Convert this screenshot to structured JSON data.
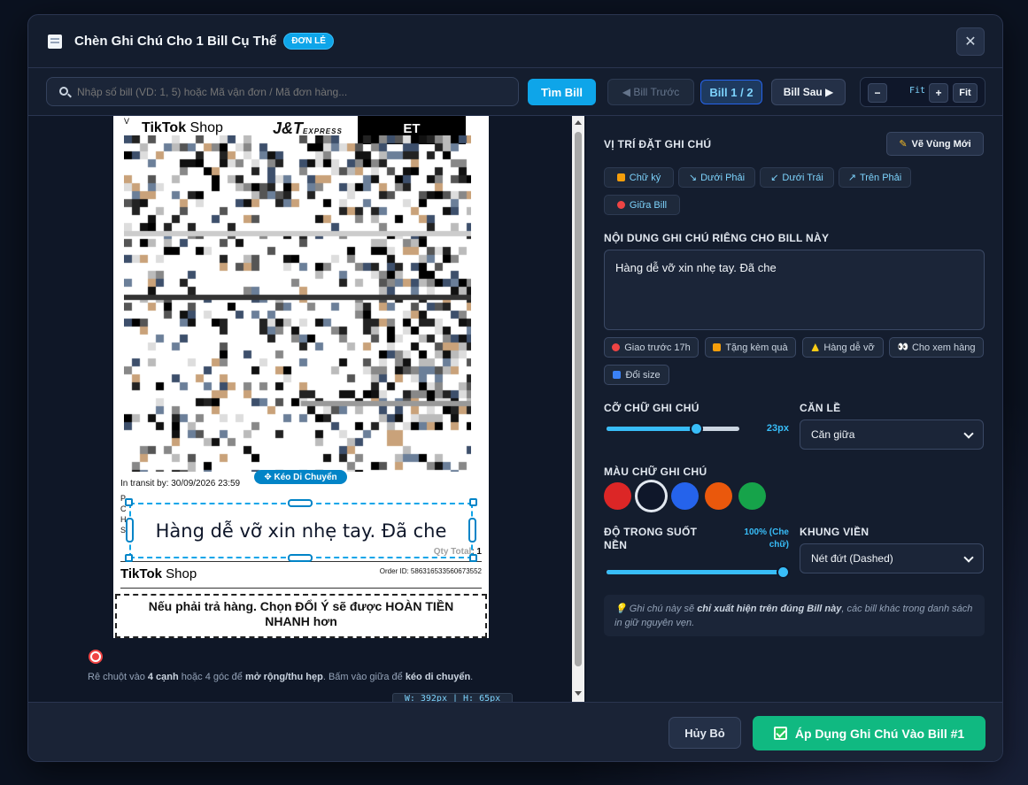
{
  "modal": {
    "title": "Chèn Ghi Chú Cho 1 Bill Cụ Thể",
    "badge": "ĐƠN LẺ",
    "close": "✕"
  },
  "toolbar": {
    "search_placeholder": "Nhập số bill (VD: 1, 5) hoặc Mã vận đơn / Mã đơn hàng...",
    "find": "Tìm Bill",
    "prev": "◀ Bill Trước",
    "counter": "Bill 1 / 2",
    "next": "Bill Sau ▶",
    "zoom_minus": "−",
    "zoom_level": "Fit",
    "zoom_plus": "+",
    "zoom_fit": "Fit"
  },
  "bill": {
    "tiktok": "TikTok",
    "shop": " Shop",
    "jt": "J&T",
    "jt_sub": "EXPRESS",
    "et": "ET",
    "v": "V",
    "transit": "In transit by: 30/09/2026 23:59",
    "left_letters": [
      "P",
      "C",
      "H",
      "S"
    ],
    "qty": "Qty Total: 1",
    "order_id": "Order ID: 586316533560673552",
    "return_text": "Nếu phải trả hàng. Chọn ĐỔI Ý sẽ được HOÀN TIỀN NHANH hơn"
  },
  "note_overlay": {
    "text": "Hàng dễ vỡ xin nhẹ tay. Đã che",
    "drag_label": "✥ Kéo Di Chuyển",
    "dims": "W: 392px | H: 65px"
  },
  "hint": {
    "p1": "Rê chuột vào ",
    "b1": "4 cạnh",
    "p2": " hoặc 4 góc để ",
    "b2": "mở rộng/thu hẹp",
    "p3": ". Bấm vào giữa để ",
    "b3": "kéo di chuyển",
    "p4": "."
  },
  "panel": {
    "position_label": "VỊ TRÍ ĐẶT GHI CHÚ",
    "draw_new": "Vẽ Vùng Mới",
    "positions": [
      "Chữ ký",
      "Dưới Phải",
      "Dưới Trái",
      "Trên Phải",
      "Giữa Bill"
    ],
    "content_label": "NỘI DUNG GHI CHÚ RIÊNG CHO BILL NÀY",
    "content_value": "Hàng dễ vỡ xin nhẹ tay. Đã che",
    "quick": [
      "Giao trước 17h",
      "Tặng kèm quà",
      "Hàng dễ vỡ",
      "Cho xem hàng",
      "Đổi size"
    ],
    "font_size_label": "CỠ CHỮ GHI CHÚ",
    "font_size_value": "23px",
    "font_size_fraction": 0.68,
    "align_label": "CĂN LỀ",
    "align_value": "Căn giữa",
    "color_label": "MÀU CHỮ GHI CHÚ",
    "colors": [
      "#dc2626",
      "#0f172a",
      "#2563eb",
      "#ea580c",
      "#16a34a"
    ],
    "selected_color": 1,
    "opacity_label": "ĐỘ TRONG SUỐT NỀN",
    "opacity_value": "100% (Che chữ)",
    "opacity_fraction": 1.0,
    "border_label": "KHUNG VIỀN",
    "border_value": "Nét đứt (Dashed)",
    "info_p1": "💡 Ghi chú này sẽ ",
    "info_b": "chỉ xuất hiện trên đúng Bill này",
    "info_p2": ", các bill khác trong danh sách in giữ nguyên vẹn."
  },
  "footer": {
    "cancel": "Hủy Bỏ",
    "apply": "Áp Dụng Ghi Chú Vào Bill #1"
  }
}
